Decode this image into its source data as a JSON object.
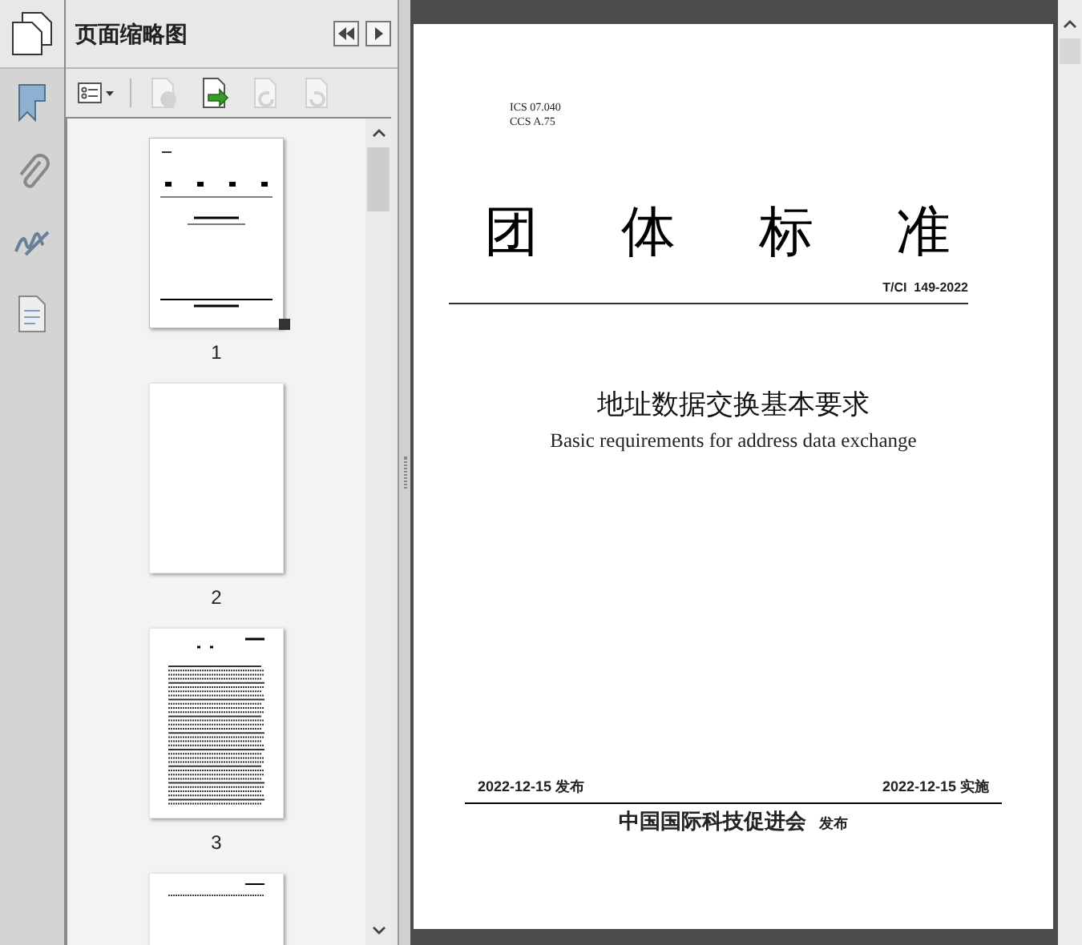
{
  "panel": {
    "title": "页面缩略图"
  },
  "toolbar": [
    {
      "kind": "options",
      "disabled": false
    },
    {
      "kind": "delete",
      "disabled": true
    },
    {
      "kind": "insert",
      "disabled": false
    },
    {
      "kind": "rotate-left",
      "disabled": true
    },
    {
      "kind": "rotate-right",
      "disabled": true
    }
  ],
  "sidebar": [
    {
      "kind": "bookmark"
    },
    {
      "kind": "attachment"
    },
    {
      "kind": "signature"
    },
    {
      "kind": "page"
    }
  ],
  "thumbnails": [
    {
      "kind": "cover",
      "label": "1",
      "selected": true
    },
    {
      "kind": "blank",
      "label": "2",
      "selected": false
    },
    {
      "kind": "contents",
      "label": "3",
      "selected": false
    },
    {
      "kind": "text",
      "selected": false
    }
  ],
  "document": {
    "codes": [
      "ICS 07.040",
      "CCS A.75"
    ],
    "heading": [
      "团",
      "体",
      "标",
      "准"
    ],
    "number": "T/CI  149-2022",
    "title": "地址数据交换基本要求",
    "subtitle": "Basic requirements for address data exchange",
    "issued": "2022-12-15 发布",
    "effective": "2022-12-15 实施",
    "publisher": "中国国际科技促进会",
    "publisher_suffix": "发布"
  }
}
